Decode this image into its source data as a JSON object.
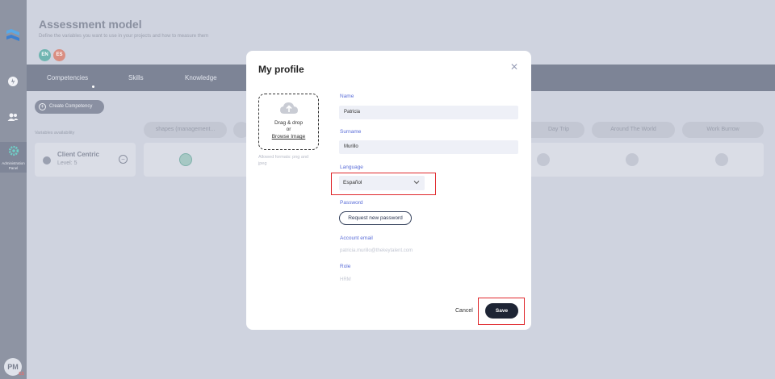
{
  "header": {
    "title": "Assessment model",
    "subtitle": "Define the variables you want to use in your projects and how to measure them",
    "languages": [
      "EN",
      "ES"
    ]
  },
  "rail": {
    "admin_label_1": "Administration",
    "admin_label_2": "Panel",
    "avatar": "PM",
    "avatar_flag": "ES"
  },
  "tabs": [
    "Competencies",
    "Skills",
    "Knowledge"
  ],
  "toolbar": {
    "create_label": "Create Competency",
    "variables_label": "Variables availability"
  },
  "columns": [
    "shapes (management...",
    "Day Trip",
    "Around The World",
    "Work Burrow"
  ],
  "rows": [
    {
      "name": "Client Centric",
      "level": "Level: 5"
    }
  ],
  "modal": {
    "title": "My profile",
    "dropzone": {
      "line1": "Drag & drop",
      "line2": "or",
      "link": "Browse Image",
      "allowed": "Allowed formats: png and jpeg"
    },
    "name_label": "Name",
    "name_value": "Patricia",
    "surname_label": "Surname",
    "surname_value": "Murillo",
    "language_label": "Language",
    "language_value": "Español",
    "password_label": "Password",
    "password_button": "Request new password",
    "email_label": "Account email",
    "email_value": "patricia.murillo@thekeytalent.com",
    "role_label": "Role",
    "role_value": "HRM",
    "cancel_label": "Cancel",
    "save_label": "Save"
  },
  "colors": {
    "accent_label": "#5a6dd8",
    "primary_button": "#1e2535",
    "highlight": "#e0282c"
  }
}
